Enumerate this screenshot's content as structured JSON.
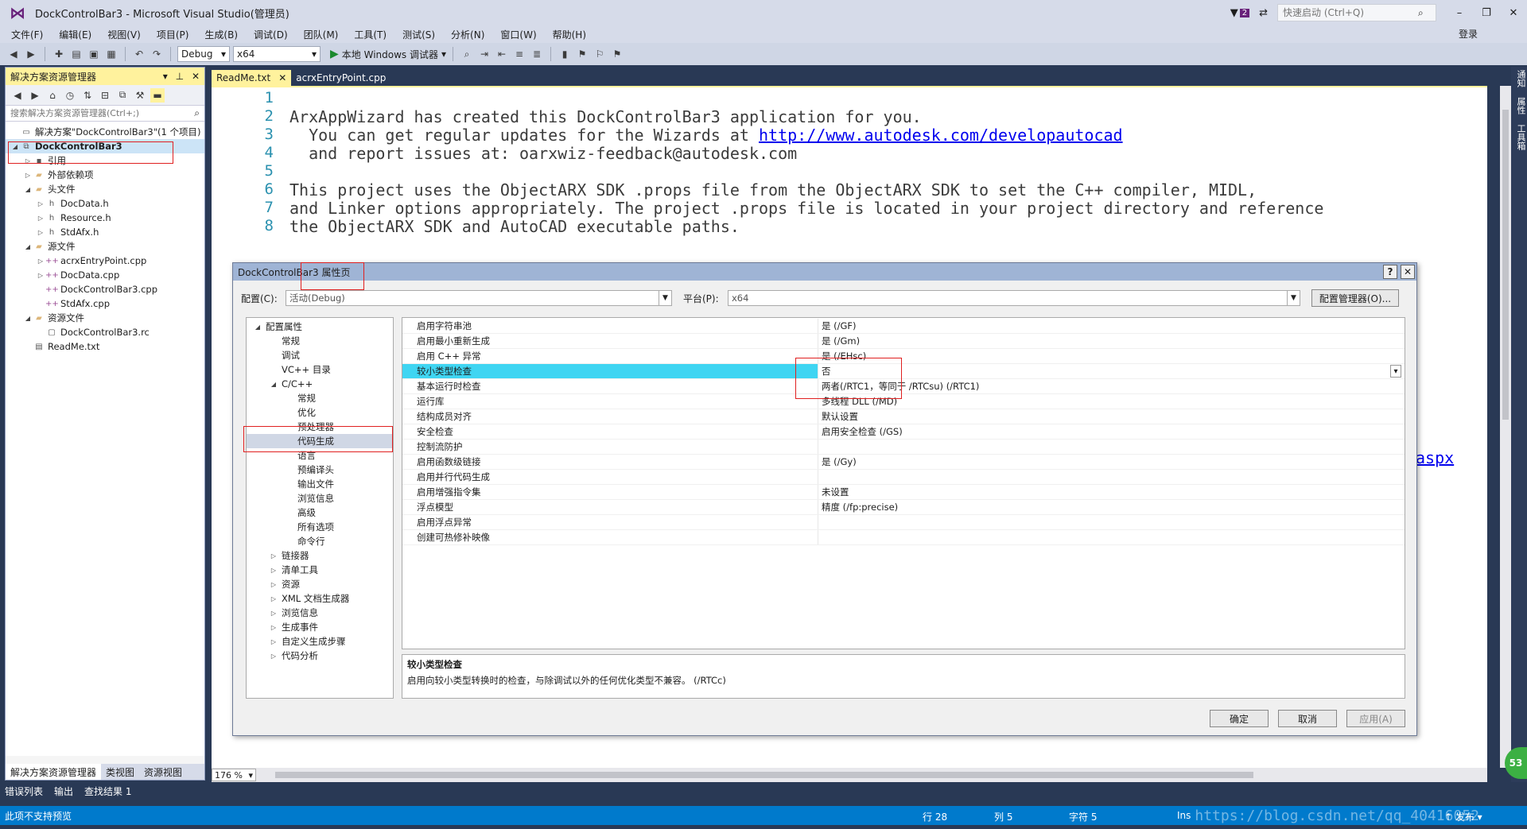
{
  "window": {
    "title": "DockControlBar3 - Microsoft Visual Studio(管理员)",
    "notification_count": "2",
    "quick_launch_placeholder": "快速启动 (Ctrl+Q)",
    "login": "登录"
  },
  "menu": [
    "文件(F)",
    "编辑(E)",
    "视图(V)",
    "项目(P)",
    "生成(B)",
    "调试(D)",
    "团队(M)",
    "工具(T)",
    "测试(S)",
    "分析(N)",
    "窗口(W)",
    "帮助(H)"
  ],
  "toolbar": {
    "config": "Debug",
    "platform": "x64",
    "run_label": "本地 Windows 调试器"
  },
  "solution_explorer": {
    "title": "解决方案资源管理器",
    "search_placeholder": "搜索解决方案资源管理器(Ctrl+;)",
    "tree": [
      {
        "label": "解决方案\"DockControlBar3\"(1 个项目)",
        "level": 0,
        "arrow": "",
        "icon": "solution-icon"
      },
      {
        "label": "DockControlBar3",
        "level": 0,
        "arrow": "down",
        "icon": "project-icon",
        "bold": true
      },
      {
        "label": "引用",
        "level": 1,
        "arrow": "right",
        "icon": "references-icon"
      },
      {
        "label": "外部依赖项",
        "level": 1,
        "arrow": "right",
        "icon": "folder-icon"
      },
      {
        "label": "头文件",
        "level": 1,
        "arrow": "down",
        "icon": "folder-icon"
      },
      {
        "label": "DocData.h",
        "level": 2,
        "arrow": "right",
        "icon": "header-file-icon"
      },
      {
        "label": "Resource.h",
        "level": 2,
        "arrow": "right",
        "icon": "header-file-icon"
      },
      {
        "label": "StdAfx.h",
        "level": 2,
        "arrow": "right",
        "icon": "header-file-icon"
      },
      {
        "label": "源文件",
        "level": 1,
        "arrow": "down",
        "icon": "folder-icon"
      },
      {
        "label": "acrxEntryPoint.cpp",
        "level": 2,
        "arrow": "right",
        "icon": "cpp-file-icon"
      },
      {
        "label": "DocData.cpp",
        "level": 2,
        "arrow": "right",
        "icon": "cpp-file-icon"
      },
      {
        "label": "DockControlBar3.cpp",
        "level": 2,
        "arrow": "",
        "icon": "cpp-file-icon"
      },
      {
        "label": "StdAfx.cpp",
        "level": 2,
        "arrow": "",
        "icon": "cpp-file-icon"
      },
      {
        "label": "资源文件",
        "level": 1,
        "arrow": "down",
        "icon": "folder-icon"
      },
      {
        "label": "DockControlBar3.rc",
        "level": 2,
        "arrow": "",
        "icon": "resource-file-icon"
      },
      {
        "label": "ReadMe.txt",
        "level": 1,
        "arrow": "",
        "icon": "text-file-icon"
      }
    ],
    "tabs": [
      "解决方案资源管理器",
      "类视图",
      "资源视图"
    ]
  },
  "editor": {
    "tabs": [
      "ReadMe.txt",
      "acrxEntryPoint.cpp"
    ],
    "lines": [
      {
        "n": "1",
        "text": ""
      },
      {
        "n": "2",
        "text": "ArxAppWizard has created this DockControlBar3 application for you."
      },
      {
        "n": "3",
        "text": "  You can get regular updates for the Wizards at ",
        "link": "http://www.autodesk.com/developautocad"
      },
      {
        "n": "4",
        "text": "  and report issues at: oarxwiz-feedback@autodesk.com"
      },
      {
        "n": "5",
        "text": ""
      },
      {
        "n": "6",
        "text": "This project uses the ObjectARX SDK .props file from the ObjectARX SDK to set the C++ compiler, MIDL,"
      },
      {
        "n": "7",
        "text": "and Linker options appropriately. The project .props file is located in your project directory and reference"
      },
      {
        "n": "8",
        "text": "the ObjectARX SDK and AutoCAD executable paths."
      }
    ],
    "hidden_link_tail": "aspx",
    "zoom": "176 %"
  },
  "right_strip": [
    "通知",
    "属性",
    "工具箱"
  ],
  "bottom_tabs": [
    "错误列表",
    "输出",
    "查找结果 1"
  ],
  "status": {
    "message": "此项不支持预览",
    "line": "行 28",
    "col": "列 5",
    "char": "字符 5",
    "mode": "Ins",
    "publish": "↑ 发布 ▾",
    "badge": "53"
  },
  "watermark": "https://blog.csdn.net/qq_40416052",
  "dialog": {
    "title": "DockControlBar3 属性页",
    "config_label": "配置(C):",
    "config_value": "活动(Debug)",
    "platform_label": "平台(P):",
    "platform_value": "x64",
    "config_manager": "配置管理器(O)...",
    "help": "?",
    "close": "✕",
    "tree": [
      {
        "label": "配置属性",
        "level": 0,
        "arrow": "down"
      },
      {
        "label": "常规",
        "level": 1,
        "arrow": ""
      },
      {
        "label": "调试",
        "level": 1,
        "arrow": ""
      },
      {
        "label": "VC++ 目录",
        "level": 1,
        "arrow": ""
      },
      {
        "label": "C/C++",
        "level": 1,
        "arrow": "down"
      },
      {
        "label": "常规",
        "level": 2,
        "arrow": ""
      },
      {
        "label": "优化",
        "level": 2,
        "arrow": ""
      },
      {
        "label": "预处理器",
        "level": 2,
        "arrow": ""
      },
      {
        "label": "代码生成",
        "level": 2,
        "arrow": "",
        "selected": true
      },
      {
        "label": "语言",
        "level": 2,
        "arrow": ""
      },
      {
        "label": "预编译头",
        "level": 2,
        "arrow": ""
      },
      {
        "label": "输出文件",
        "level": 2,
        "arrow": ""
      },
      {
        "label": "浏览信息",
        "level": 2,
        "arrow": ""
      },
      {
        "label": "高级",
        "level": 2,
        "arrow": ""
      },
      {
        "label": "所有选项",
        "level": 2,
        "arrow": ""
      },
      {
        "label": "命令行",
        "level": 2,
        "arrow": ""
      },
      {
        "label": "链接器",
        "level": 1,
        "arrow": "right"
      },
      {
        "label": "清单工具",
        "level": 1,
        "arrow": "right"
      },
      {
        "label": "资源",
        "level": 1,
        "arrow": "right"
      },
      {
        "label": "XML 文档生成器",
        "level": 1,
        "arrow": "right"
      },
      {
        "label": "浏览信息",
        "level": 1,
        "arrow": "right"
      },
      {
        "label": "生成事件",
        "level": 1,
        "arrow": "right"
      },
      {
        "label": "自定义生成步骤",
        "level": 1,
        "arrow": "right"
      },
      {
        "label": "代码分析",
        "level": 1,
        "arrow": "right"
      }
    ],
    "properties": [
      {
        "name": "启用字符串池",
        "value": "是 (/GF)"
      },
      {
        "name": "启用最小重新生成",
        "value": "是 (/Gm)"
      },
      {
        "name": "启用 C++ 异常",
        "value": "是 (/EHsc)"
      },
      {
        "name": "较小类型检查",
        "value": "否",
        "selected": true
      },
      {
        "name": "基本运行时检查",
        "value": "两者(/RTC1，等同于 /RTCsu) (/RTC1)"
      },
      {
        "name": "运行库",
        "value": "多线程 DLL (/MD)"
      },
      {
        "name": "结构成员对齐",
        "value": "默认设置"
      },
      {
        "name": "安全检查",
        "value": "启用安全检查 (/GS)"
      },
      {
        "name": "控制流防护",
        "value": ""
      },
      {
        "name": "启用函数级链接",
        "value": "是 (/Gy)"
      },
      {
        "name": "启用并行代码生成",
        "value": ""
      },
      {
        "name": "启用增强指令集",
        "value": "未设置"
      },
      {
        "name": "浮点模型",
        "value": "精度 (/fp:precise)"
      },
      {
        "name": "启用浮点异常",
        "value": ""
      },
      {
        "name": "创建可热修补映像",
        "value": ""
      }
    ],
    "description_title": "较小类型检查",
    "description_text": "启用向较小类型转换时的检查，与除调试以外的任何优化类型不兼容。    (/RTCc)",
    "ok": "确定",
    "cancel": "取消",
    "apply": "应用(A)"
  }
}
